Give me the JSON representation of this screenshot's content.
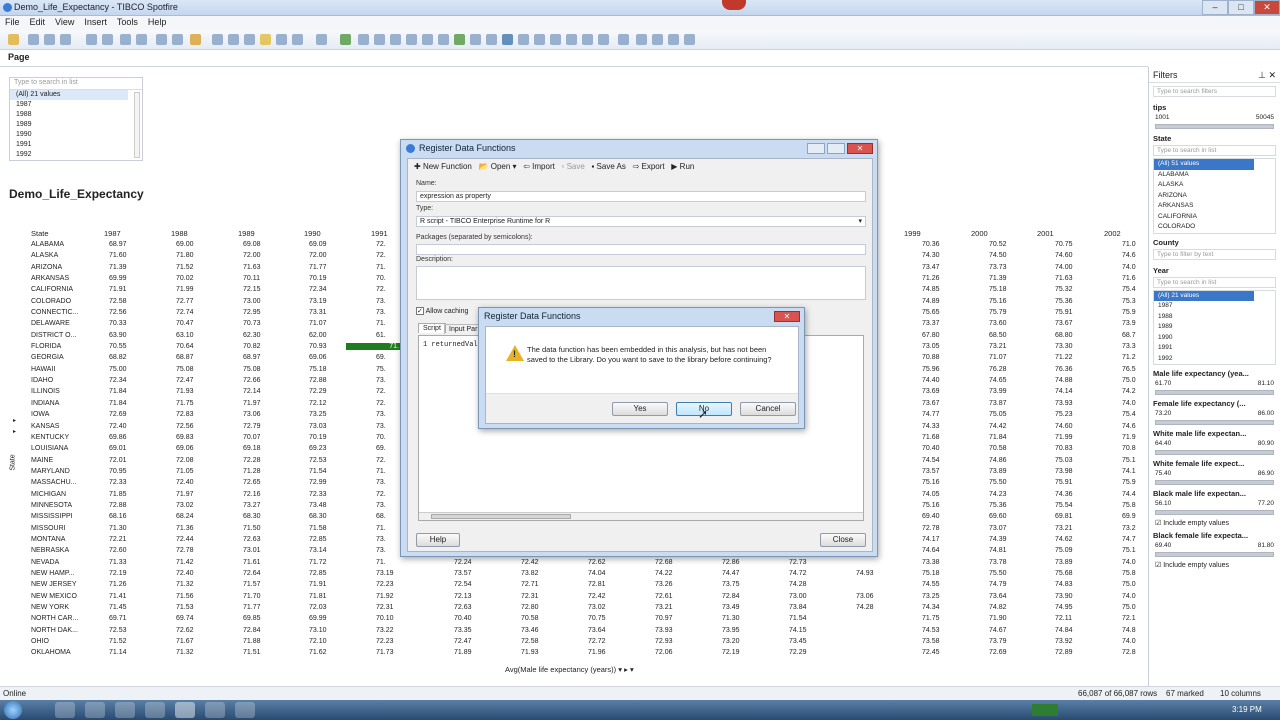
{
  "window": {
    "title": "Demo_Life_Expectancy - TIBCO Spotfire"
  },
  "menu": [
    "File",
    "Edit",
    "View",
    "Insert",
    "Tools",
    "Help"
  ],
  "page": {
    "tab": "Page"
  },
  "listbox": {
    "placeholder": "Type to search in list",
    "items": [
      "(All) 21 values",
      "1987",
      "1988",
      "1989",
      "1990",
      "1991",
      "1992"
    ]
  },
  "table": {
    "title": "Demo_Life_Expectancy",
    "state_header": "State",
    "year_headers_left": [
      "1987",
      "1988",
      "1989",
      "1990",
      "1991"
    ],
    "year_headers_right": [
      "1999",
      "2000",
      "2001",
      "2002"
    ],
    "rows": [
      {
        "state": "ALABAMA",
        "left": [
          "68.97",
          "69.00",
          "69.08",
          "69.09",
          "72."
        ],
        "right": [
          "70.36",
          "70.52",
          "70.75",
          "71.0"
        ]
      },
      {
        "state": "ALASKA",
        "left": [
          "71.60",
          "71.80",
          "72.00",
          "72.00",
          "72."
        ],
        "right": [
          "74.30",
          "74.50",
          "74.60",
          "74.6"
        ]
      },
      {
        "state": "ARIZONA",
        "left": [
          "71.39",
          "71.52",
          "71.63",
          "71.77",
          "71."
        ],
        "right": [
          "73.47",
          "73.73",
          "74.00",
          "74.0"
        ]
      },
      {
        "state": "ARKANSAS",
        "left": [
          "69.99",
          "70.02",
          "70.11",
          "70.19",
          "70."
        ],
        "right": [
          "71.26",
          "71.39",
          "71.63",
          "71.6"
        ]
      },
      {
        "state": "CALIFORNIA",
        "left": [
          "71.91",
          "71.99",
          "72.15",
          "72.34",
          "72."
        ],
        "right": [
          "74.85",
          "75.18",
          "75.32",
          "75.4"
        ]
      },
      {
        "state": "COLORADO",
        "left": [
          "72.58",
          "72.77",
          "73.00",
          "73.19",
          "73."
        ],
        "right": [
          "74.89",
          "75.16",
          "75.36",
          "75.3"
        ]
      },
      {
        "state": "CONNECTIC...",
        "left": [
          "72.56",
          "72.74",
          "72.95",
          "73.31",
          "73."
        ],
        "right": [
          "75.65",
          "75.79",
          "75.91",
          "75.9"
        ]
      },
      {
        "state": "DELAWARE",
        "left": [
          "70.33",
          "70.47",
          "70.73",
          "71.07",
          "71."
        ],
        "right": [
          "73.37",
          "73.60",
          "73.67",
          "73.9"
        ]
      },
      {
        "state": "DISTRICT O...",
        "left": [
          "63.90",
          "63.10",
          "62.30",
          "62.00",
          "61."
        ],
        "right": [
          "67.80",
          "68.50",
          "68.80",
          "68.7"
        ]
      },
      {
        "state": "FLORIDA",
        "left": [
          "70.55",
          "70.64",
          "70.82",
          "70.93",
          "71."
        ],
        "right": [
          "73.05",
          "73.21",
          "73.30",
          "73.3"
        ]
      },
      {
        "state": "GEORGIA",
        "left": [
          "68.82",
          "68.87",
          "68.97",
          "69.06",
          "69."
        ],
        "right": [
          "70.88",
          "71.07",
          "71.22",
          "71.2"
        ]
      },
      {
        "state": "HAWAII",
        "left": [
          "75.00",
          "75.08",
          "75.08",
          "75.18",
          "75."
        ],
        "right": [
          "75.96",
          "76.28",
          "76.36",
          "76.5"
        ]
      },
      {
        "state": "IDAHO",
        "left": [
          "72.34",
          "72.47",
          "72.66",
          "72.88",
          "73."
        ],
        "right": [
          "74.40",
          "74.65",
          "74.88",
          "75.0"
        ]
      },
      {
        "state": "ILLINOIS",
        "left": [
          "71.84",
          "71.93",
          "72.14",
          "72.29",
          "72."
        ],
        "right": [
          "73.69",
          "73.99",
          "74.14",
          "74.2"
        ]
      },
      {
        "state": "INDIANA",
        "left": [
          "71.84",
          "71.75",
          "71.97",
          "72.12",
          "72."
        ],
        "right": [
          "73.67",
          "73.87",
          "73.93",
          "74.0"
        ]
      },
      {
        "state": "IOWA",
        "left": [
          "72.69",
          "72.83",
          "73.06",
          "73.25",
          "73."
        ],
        "right": [
          "74.77",
          "75.05",
          "75.23",
          "75.4"
        ]
      },
      {
        "state": "KANSAS",
        "left": [
          "72.40",
          "72.56",
          "72.79",
          "73.03",
          "73."
        ],
        "right": [
          "74.33",
          "74.42",
          "74.60",
          "74.6"
        ]
      },
      {
        "state": "KENTUCKY",
        "left": [
          "69.86",
          "69.83",
          "70.07",
          "70.19",
          "70."
        ],
        "right": [
          "71.68",
          "71.84",
          "71.99",
          "71.9"
        ]
      },
      {
        "state": "LOUISIANA",
        "left": [
          "69.01",
          "69.06",
          "69.18",
          "69.23",
          "69."
        ],
        "right": [
          "70.40",
          "70.58",
          "70.83",
          "70.8"
        ]
      },
      {
        "state": "MAINE",
        "left": [
          "72.01",
          "72.08",
          "72.28",
          "72.53",
          "72."
        ],
        "right": [
          "74.54",
          "74.86",
          "75.03",
          "75.1"
        ]
      },
      {
        "state": "MARYLAND",
        "left": [
          "70.95",
          "71.05",
          "71.28",
          "71.54",
          "71."
        ],
        "right": [
          "73.57",
          "73.89",
          "73.98",
          "74.1"
        ]
      },
      {
        "state": "MASSACHU...",
        "left": [
          "72.33",
          "72.40",
          "72.65",
          "72.99",
          "73."
        ],
        "right": [
          "75.16",
          "75.50",
          "75.91",
          "75.9"
        ]
      },
      {
        "state": "MICHIGAN",
        "left": [
          "71.85",
          "71.97",
          "72.16",
          "72.33",
          "72."
        ],
        "right": [
          "74.05",
          "74.23",
          "74.36",
          "74.4"
        ]
      },
      {
        "state": "MINNESOTA",
        "left": [
          "72.88",
          "73.02",
          "73.27",
          "73.48",
          "73."
        ],
        "right": [
          "75.16",
          "75.36",
          "75.54",
          "75.8"
        ]
      },
      {
        "state": "MISSISSIPPI",
        "left": [
          "68.16",
          "68.24",
          "68.30",
          "68.30",
          "68."
        ],
        "right": [
          "69.40",
          "69.60",
          "69.81",
          "69.9"
        ]
      },
      {
        "state": "MISSOURI",
        "left": [
          "71.30",
          "71.36",
          "71.50",
          "71.58",
          "71."
        ],
        "right": [
          "72.78",
          "73.07",
          "73.21",
          "73.2"
        ]
      },
      {
        "state": "MONTANA",
        "left": [
          "72.21",
          "72.44",
          "72.63",
          "72.85",
          "73."
        ],
        "right": [
          "74.17",
          "74.39",
          "74.62",
          "74.7"
        ]
      },
      {
        "state": "NEBRASKA",
        "left": [
          "72.60",
          "72.78",
          "73.01",
          "73.14",
          "73."
        ],
        "right": [
          "74.64",
          "74.81",
          "75.09",
          "75.1"
        ]
      },
      {
        "state": "NEVADA",
        "left": [
          "71.33",
          "71.42",
          "71.61",
          "71.72",
          "71."
        ],
        "right": [
          "73.38",
          "73.78",
          "73.89",
          "74.0"
        ]
      },
      {
        "state": "NEW HAMP...",
        "left": [
          "72.19",
          "72.40",
          "72.64",
          "72.85",
          "73.19"
        ],
        "right": [
          "75.18",
          "75.50",
          "75.68",
          "75.8"
        ]
      },
      {
        "state": "NEW JERSEY",
        "left": [
          "71.26",
          "71.32",
          "71.57",
          "71.91",
          "72.23"
        ],
        "right": [
          "74.55",
          "74.79",
          "74.83",
          "75.0"
        ]
      },
      {
        "state": "NEW MEXICO",
        "left": [
          "71.41",
          "71.56",
          "71.70",
          "71.81",
          "71.92"
        ],
        "right": [
          "73.25",
          "73.64",
          "73.90",
          "74.0"
        ]
      },
      {
        "state": "NEW YORK",
        "left": [
          "71.45",
          "71.53",
          "71.77",
          "72.03",
          "72.31"
        ],
        "right": [
          "74.34",
          "74.82",
          "74.95",
          "75.0"
        ]
      },
      {
        "state": "NORTH CAR...",
        "left": [
          "69.71",
          "69.74",
          "69.85",
          "69.99",
          "70.10"
        ],
        "right": [
          "71.75",
          "71.90",
          "72.11",
          "72.1"
        ]
      },
      {
        "state": "NORTH DAK...",
        "left": [
          "72.53",
          "72.62",
          "72.84",
          "73.10",
          "73.22"
        ],
        "right": [
          "74.53",
          "74.67",
          "74.84",
          "74.8"
        ]
      },
      {
        "state": "OHIO",
        "left": [
          "71.52",
          "71.67",
          "71.88",
          "72.10",
          "72.23"
        ],
        "right": [
          "73.58",
          "73.79",
          "73.92",
          "74.0"
        ]
      },
      {
        "state": "OKLAHOMA",
        "left": [
          "71.14",
          "71.32",
          "71.51",
          "71.62",
          "71.73"
        ],
        "right": [
          "72.45",
          "72.69",
          "72.89",
          "72.8"
        ]
      }
    ],
    "mid_rows": [
      {
        "state": "NEVADA",
        "vals": [
          "72.24",
          "72.42",
          "72.62",
          "72.68",
          "72.86",
          "72.73"
        ]
      },
      {
        "state": "NEW HAMP...",
        "vals": [
          "73.57",
          "73.82",
          "74.04",
          "74.22",
          "74.47",
          "74.72",
          "74.93"
        ]
      },
      {
        "state": "NEW JERSEY",
        "vals": [
          "72.54",
          "72.71",
          "72.81",
          "73.26",
          "73.75",
          "74.28"
        ]
      },
      {
        "state": "NEW MEXICO",
        "vals": [
          "72.13",
          "72.31",
          "72.42",
          "72.61",
          "72.84",
          "73.00",
          "73.06"
        ]
      },
      {
        "state": "NEW YORK",
        "vals": [
          "72.63",
          "72.80",
          "73.02",
          "73.21",
          "73.49",
          "73.84",
          "74.28"
        ]
      },
      {
        "state": "NORTH CAR...",
        "vals": [
          "70.40",
          "70.58",
          "70.75",
          "70.97",
          "71.30",
          "71.54"
        ]
      },
      {
        "state": "NORTH DAK...",
        "vals": [
          "73.35",
          "73.46",
          "73.64",
          "73.93",
          "73.95",
          "74.15"
        ]
      },
      {
        "state": "OHIO",
        "vals": [
          "72.47",
          "72.58",
          "72.72",
          "72.93",
          "73.20",
          "73.45"
        ]
      },
      {
        "state": "OKLAHOMA",
        "vals": [
          "71.89",
          "71.93",
          "71.96",
          "72.06",
          "72.19",
          "72.29"
        ]
      }
    ],
    "state_axis": "State",
    "avg_label": "Avg(Male life expectancy (years))"
  },
  "status": {
    "left": "Online",
    "rows": "66,087 of 66,087 rows",
    "marked": "67 marked",
    "columns": "10 columns"
  },
  "clock": "3:19 PM",
  "filters": {
    "title": "Filters",
    "search_placeholder": "Type to search filters",
    "tips_label": "tips",
    "tips_min": "1001",
    "tips_max": "50045",
    "state_label": "State",
    "state_placeholder": "Type to search in list",
    "state_items": [
      "(All) 51 values",
      "ALABAMA",
      "ALASKA",
      "ARIZONA",
      "ARKANSAS",
      "CALIFORNIA",
      "COLORADO"
    ],
    "county_label": "County",
    "county_placeholder": "Type to filter by text",
    "year_label": "Year",
    "year_placeholder": "Type to search in list",
    "year_items": [
      "(All) 21 values",
      "1987",
      "1988",
      "1989",
      "1990",
      "1991",
      "1992"
    ],
    "ranges": [
      {
        "label": "Male life expectancy (yea...",
        "min": "61.70",
        "max": "81.10"
      },
      {
        "label": "Female life expectancy (...",
        "min": "73.20",
        "max": "86.00"
      },
      {
        "label": "White male life expectan...",
        "min": "64.40",
        "max": "80.90"
      },
      {
        "label": "White female life expect...",
        "min": "75.40",
        "max": "86.90"
      },
      {
        "label": "Black male life expectan...",
        "min": "56.10",
        "max": "77.20"
      },
      {
        "label": "Black female life expecta...",
        "min": "69.40",
        "max": "81.80"
      }
    ],
    "include_empty": "Include empty values"
  },
  "register_dialog": {
    "title": "Register Data Functions",
    "toolbar": [
      "New Function",
      "Open",
      "Import",
      "Save",
      "Save As",
      "Export",
      "Run"
    ],
    "name_label": "Name:",
    "name_value": "expression as property",
    "type_label": "Type:",
    "type_value": "R script - TIBCO Enterprise Runtime for R",
    "packages_label": "Packages (separated by semicolons):",
    "description_label": "Description:",
    "allow_caching": "Allow caching",
    "tabs": [
      "Script",
      "Input Par"
    ],
    "script_text": "1 returnedVal",
    "help": "Help",
    "close": "Close"
  },
  "confirm_dialog": {
    "title": "Register Data Functions",
    "message": "The data function has been embedded in this analysis, but has not been saved to the Library. Do you want to save to the library before continuing?",
    "yes": "Yes",
    "no": "No",
    "cancel": "Cancel"
  }
}
